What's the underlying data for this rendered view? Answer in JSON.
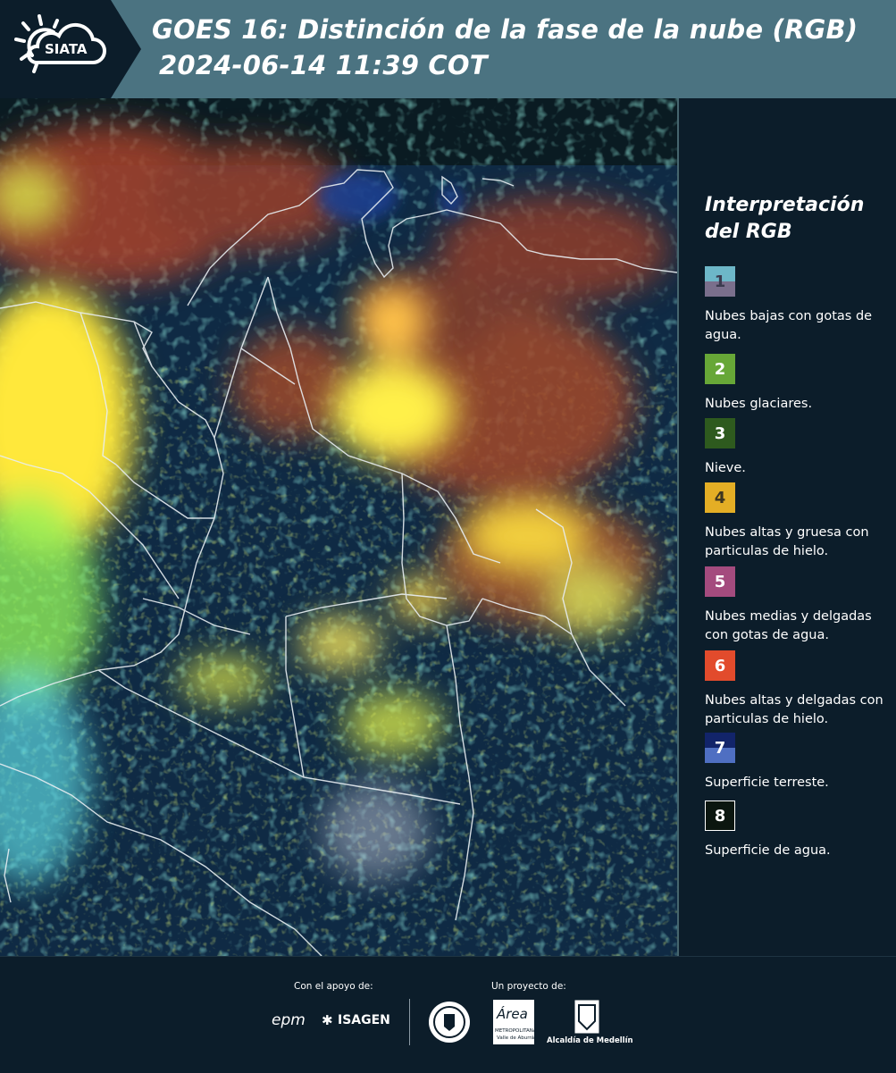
{
  "header": {
    "logo_text": "SIATA",
    "title_line1": "GOES 16: Distinción de la fase de la nube (RGB)",
    "title_line2": "2024-06-14 11:39 COT"
  },
  "legend": {
    "title": "Interpretación del RGB",
    "items": [
      {
        "number": "1",
        "label": "Nubes bajas con gotas de agua.",
        "color_top": "#6db7c8",
        "color_bottom": "#7a6f8c",
        "text_color": "#3b3b4f"
      },
      {
        "number": "2",
        "label": "Nubes glaciares.",
        "color_top": "#67a737",
        "color_bottom": "#67a737",
        "text_color": "#ffffff"
      },
      {
        "number": "3",
        "label": "Nieve.",
        "color_top": "#2e5a1e",
        "color_bottom": "#2e5a1e",
        "text_color": "#ffffff"
      },
      {
        "number": "4",
        "label": "Nubes altas y gruesa con particulas de hielo.",
        "color_top": "#e4ae25",
        "color_bottom": "#e4ae25",
        "text_color": "#3d3520"
      },
      {
        "number": "5",
        "label": "Nubes medias y delgadas con gotas de agua.",
        "color_top": "#a44b7e",
        "color_bottom": "#a44b7e",
        "text_color": "#ffffff"
      },
      {
        "number": "6",
        "label": "Nubes altas y delgadas con particulas de hielo.",
        "color_top": "#e24b2c",
        "color_bottom": "#e24b2c",
        "text_color": "#ffffff"
      },
      {
        "number": "7",
        "label": "Superficie terreste.",
        "color_top": "#12246a",
        "color_bottom": "#4f6fc2",
        "text_color": "#ffffff"
      },
      {
        "number": "8",
        "label": "Superficie de agua.",
        "color_top": "#0b1610",
        "color_bottom": "#0b1610",
        "text_color": "#ffffff"
      }
    ]
  },
  "footer": {
    "support_label": "Con el apoyo de:",
    "project_label": "Un proyecto de:",
    "epm_text": "epm",
    "isagen_text": "ISAGEN",
    "area_text": "Área",
    "area_sub1": "METROPOLITANA",
    "area_sub2": "Valle de Aburrá",
    "alcaldia_text": "Alcaldía de Medellín"
  }
}
